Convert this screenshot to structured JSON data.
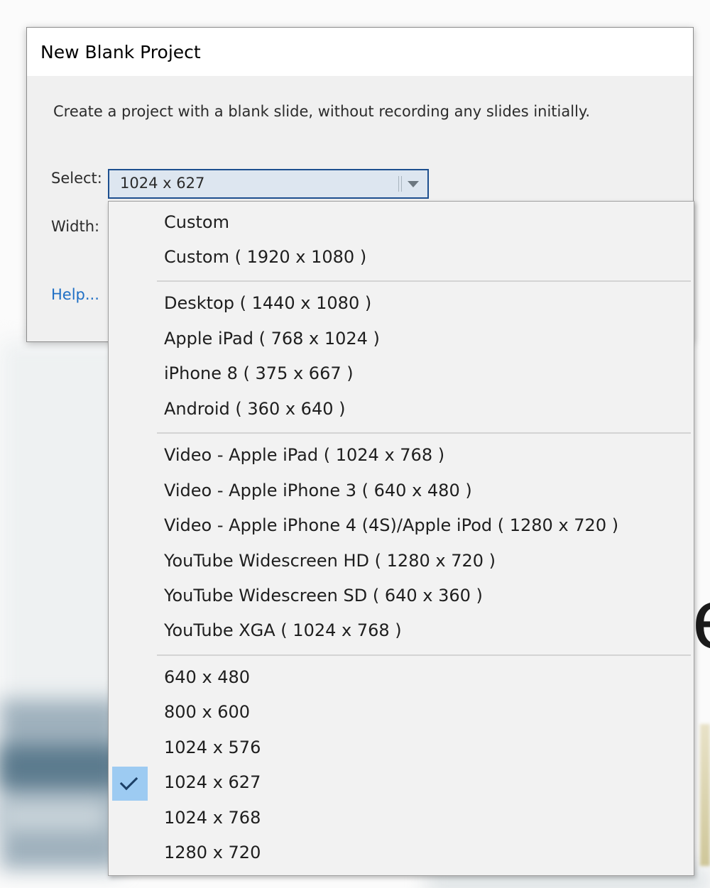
{
  "dialog": {
    "title": "New Blank Project",
    "description": "Create a project with a blank slide, without recording any slides initially.",
    "select_label": "Select:",
    "width_label": "Width:",
    "help_link": "Help...",
    "selected_value": "1024 x 627"
  },
  "dropdown": {
    "groups": [
      [
        "Custom",
        "Custom ( 1920 x 1080 )"
      ],
      [
        "Desktop ( 1440 x 1080 )",
        "Apple iPad ( 768 x 1024 )",
        "iPhone 8 ( 375 x 667 )",
        "Android ( 360 x 640 )"
      ],
      [
        "Video - Apple iPad ( 1024 x 768 )",
        "Video - Apple iPhone 3 ( 640 x 480 )",
        "Video - Apple iPhone 4 (4S)/Apple iPod ( 1280 x 720 )",
        "YouTube Widescreen HD ( 1280 x 720 )",
        "YouTube Widescreen SD ( 640 x 360 )",
        "YouTube XGA ( 1024 x 768 )"
      ],
      [
        "640 x 480",
        "800 x 600",
        "1024 x 576",
        "1024 x 627",
        "1024 x 768",
        "1280 x 720"
      ]
    ],
    "checked_item": "1024 x 627"
  },
  "colors": {
    "accent_border": "#1d4f8f",
    "check_highlight": "#9dcbf2",
    "link": "#1f6fc5"
  }
}
